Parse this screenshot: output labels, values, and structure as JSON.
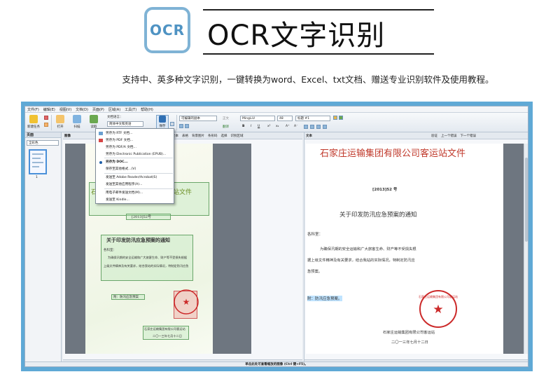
{
  "banner": {
    "badge": "OCR",
    "title": "OCR文字识别",
    "description": "支持中、英多种文字识别，一键转换为word、Excel、txt文档、赠送专业识别软件及使用教程。"
  },
  "app": {
    "menu": [
      "文件(F)",
      "编辑(E)",
      "视图(V)",
      "文档(D)",
      "页面(P)",
      "区域(A)",
      "工具(T)",
      "帮助(H)"
    ],
    "toolbar": {
      "new_task": "新建任务",
      "open": "打开",
      "scan": "扫描",
      "read": "读取",
      "save": "保存",
      "doc_language_label": "文档语言：",
      "doc_language_value": "简体中文和英语",
      "editable_copy": "可编辑的副本",
      "style": "正文",
      "font": "MingLiU",
      "font_size": "48",
      "heading": "标题 #1",
      "translate": "翻译",
      "find_previous": "上一个错误",
      "find_next": "下一个错误",
      "validate": "验证"
    },
    "dropdown": {
      "items": [
        "另存为 RTF 文档...",
        "另存为 PDF 文档...",
        "另存为 PDF/A 文档...",
        "另存为 Electronic Publication (EPUB)...",
        "另存为 DOC...",
        "保存至其他格式...(V)",
        "发送至 Adobe Reader/Acrobat(S)",
        "发送至其他应用程序(A)...",
        "用电子邮件发送文档(M)...",
        "发送至 Kindle..."
      ],
      "selected_index": 4
    },
    "pages_panel": {
      "title": "页面",
      "filter": "全彩色",
      "page_number": "1"
    },
    "image_panel": {
      "title": "图像",
      "toolbar_items": [
        "分析",
        "文本",
        "表格",
        "背景图片",
        "条形码",
        "选择",
        "识别区域"
      ],
      "zoom": "47%",
      "doc": {
        "heading": "石家庄运输集团有限公司客运站文件",
        "doc_number": "[2013]52号",
        "notice_title": "关于印发防汛应急预案的通知",
        "salutation": "各科室：",
        "body_1": "为确保汛期的安全运输和广大旅客生命、财产等不受损失根据",
        "body_2": "上级文件精神及有关要求，结合我站的实际情况，特制定防汛应急",
        "attachment": "附：防汛应急预案",
        "signature": "石家庄运输集团有限公司客运站",
        "date": "二〇一三年七月十二日"
      }
    },
    "text_panel": {
      "title": "文本",
      "zoom": "45%",
      "heading": "石家庄运输集团有限公司客运站文件",
      "doc_number": "[2013]52 号",
      "notice_title": "关于印发防汛应急预案的通知",
      "salutation": "各科室：",
      "body_1": "为确保汛期的安全运输和广大旅客生命、财产等不受损失根",
      "body_2": "据上级文件精神及有关要求，结合我站的实际情况，特制定防汛应",
      "body_3": "急预案。",
      "attachment": "附：防汛应急预案。",
      "signature": "石家庄运输集团有限公司客运站",
      "date": "二〇一三年七月十二日",
      "seal_text": "石家庄运输集团有限公司客运站"
    },
    "status": "单击此处可查看缩放的图像 (Ctrl 键+F5)。"
  },
  "colors": {
    "frame": "#5fa9d6",
    "badge": "#7fb3d5",
    "seal": "#cc2a2a",
    "highlight": "#bfe3ff"
  }
}
